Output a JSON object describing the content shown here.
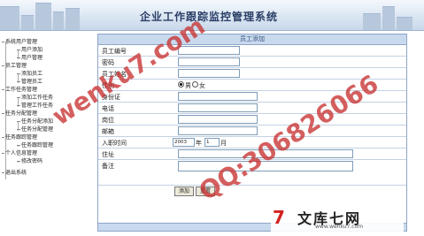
{
  "app": {
    "title": "企业工作跟踪监控管理系统"
  },
  "sidebar": {
    "groups": [
      {
        "label": "系统用户管理",
        "items": [
          "用户添加",
          "用户管理"
        ]
      },
      {
        "label": "员工管理",
        "items": [
          "添加员工",
          "管理员工"
        ]
      },
      {
        "label": "工作任务管理",
        "items": [
          "添加工作任务",
          "管理工作任务"
        ]
      },
      {
        "label": "任务分配管理",
        "items": [
          "任务分配添加",
          "任务分配管理"
        ]
      },
      {
        "label": "任务跟踪管理",
        "items": [
          "任务跟踪管理"
        ]
      },
      {
        "label": "个人信息管理",
        "items": [
          "修改密码"
        ]
      },
      {
        "label": "退出系统",
        "items": []
      }
    ]
  },
  "form": {
    "title": "员工添加",
    "fields": {
      "emp_no": "员工编号",
      "password": "密码",
      "emp_name": "员工姓名",
      "gender": "性别",
      "gender_male": "男",
      "gender_female": "女",
      "id_card": "身份证",
      "phone": "电话",
      "position": "岗位",
      "email": "邮箱",
      "entry_date": "入职时间",
      "year": "2003",
      "year_unit": "年",
      "month": "1",
      "month_unit": "月",
      "address": "住址",
      "remark": "备注"
    },
    "buttons": {
      "submit": "添加",
      "reset": "重置"
    }
  },
  "watermarks": {
    "site": "wenku7.com",
    "qq": "QQ:306826066",
    "logo_mark": "7",
    "logo_name": "文库七网",
    "logo_url": "www.wenku7.com"
  }
}
